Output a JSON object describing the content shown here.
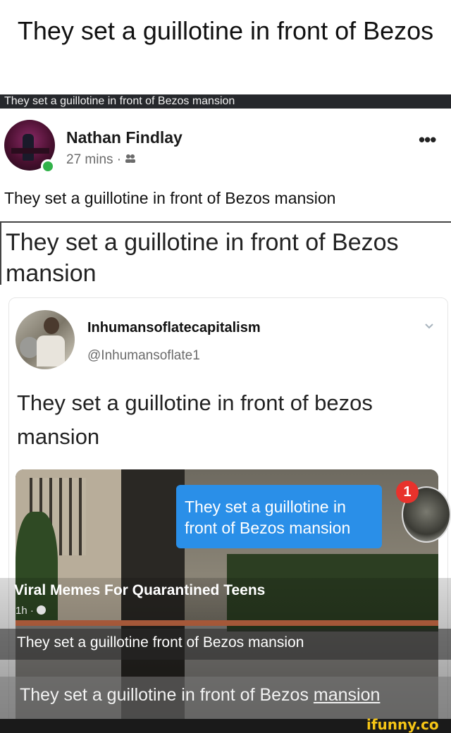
{
  "header": {
    "title": "They set a guillotine in front of Bezos"
  },
  "screenshot_bar": {
    "text": "They set a guillotine in front of Bezos mansion"
  },
  "post": {
    "author": "Nathan Findlay",
    "time": "27 mins ·",
    "audience_icon": "friends-icon",
    "text": "They set a guillotine in front of Bezos mansion",
    "more_icon": "more-options-icon"
  },
  "shared_post": {
    "title": "They set a guillotine in front of Bezos mansion"
  },
  "tweet": {
    "name": "Inhumansoflatecapitalism",
    "handle": "@Inhumansoflate1",
    "text": "They set a guillotine in front of bezos mansion"
  },
  "media": {
    "bubble_text": "They set a guillotine in front of Bezos mansion",
    "badge_count": "1",
    "page_name": "Viral Memes For Quarantined Teens",
    "page_time": "1h ·",
    "caption": "They set a guillotine front of Bezos mansion",
    "bottom_text_a": "They set a guillotine in front of Bezos ",
    "bottom_text_b": "mansion"
  },
  "footer": {
    "watermark": "ifunny.co"
  },
  "colors": {
    "online": "#32b24a",
    "bubble": "#2a8fe8",
    "badge": "#e8322c",
    "watermark": "#f5c416"
  }
}
